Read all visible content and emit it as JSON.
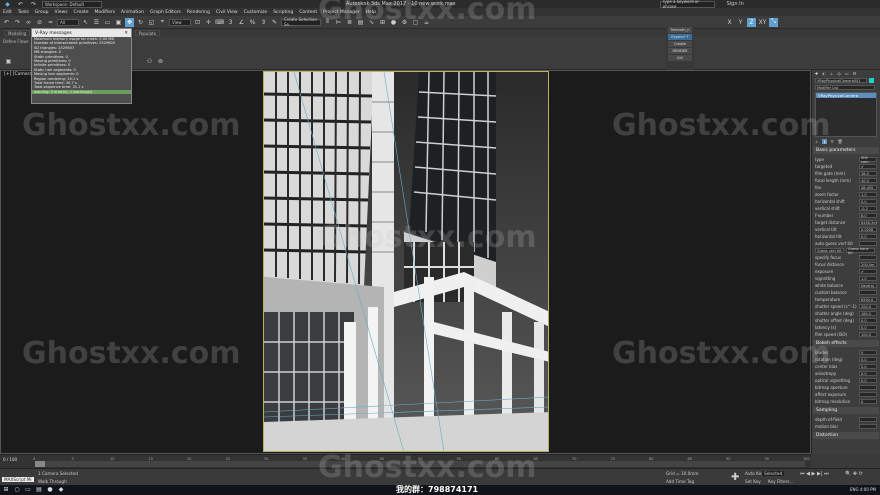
{
  "titlebar": {
    "workspace": "Workspace: Default",
    "app_title": "Autodesk 3ds Max 2017  -  10 new work.max",
    "search_placeholder": "Type a keyword or phrase",
    "sign_in": "Sign In"
  },
  "menu": [
    "Edit",
    "Tools",
    "Group",
    "Views",
    "Create",
    "Modifiers",
    "Animation",
    "Graph Editors",
    "Rendering",
    "Civil View",
    "Customize",
    "Scripting",
    "Content",
    "Project Manager",
    "Help"
  ],
  "toolbar": {
    "filter": "All",
    "view": "View",
    "selection_set": "Create Selection Se...",
    "axes": [
      "X",
      "Y",
      "Z",
      "XY"
    ]
  },
  "ribbon": {
    "tabs": [
      "Modeling",
      "Freeform",
      "Selection",
      "Object Paint",
      "Populate"
    ],
    "define_flows": "Define Flows"
  },
  "stats_window": {
    "title": "V-Ray messages",
    "lines": [
      "Maximum memory usage for mesh: 0.00 MB",
      "Number of intersectable primitives: 2529805",
      "SD triangles: 2529807",
      "MB triangles: 0",
      "Static primitives: 0",
      "Moving primitives: 0",
      "Infinite primitives: 0",
      "Static hair segments: 0",
      "Moving hair segments: 0",
      "Region rendering: 24.1 s",
      "Total frame time: 30.7 s",
      "Total sequence time: 31.1 s",
      "warning: 0 error(s), 1 warning(s)"
    ]
  },
  "render_panel": {
    "active_shade": "ActiveShade",
    "buttons": [
      "Tsmooth_n",
      "Expand ↑",
      "Create",
      "RENDER",
      "Kill"
    ]
  },
  "viewport": {
    "label": "[+] [Camera001] [Shaded]"
  },
  "command_panel": {
    "object_name": "VRayPhysicalCamera001",
    "modifier_list": "Modifier List",
    "stack_item": "VRayPhysicalCamera",
    "sections": {
      "basic": "Basic parameters",
      "bokeh": "Bokeh effects",
      "sampling": "Sampling",
      "distortion": "Distortion"
    },
    "params": [
      {
        "label": "type",
        "value": "Still cam"
      },
      {
        "label": "targeted",
        "value": "✔"
      },
      {
        "label": "film gate (mm)",
        "value": "36.0"
      },
      {
        "label": "focal length (mm)",
        "value": "40.0"
      },
      {
        "label": "fov",
        "value": "48.455"
      },
      {
        "label": "zoom factor",
        "value": "1.0"
      },
      {
        "label": "horizontal shift",
        "value": "0.0"
      },
      {
        "label": "vertical shift",
        "value": "-0.2"
      },
      {
        "label": "f-number",
        "value": "8.0"
      },
      {
        "label": "target distance",
        "value": "8456.3m"
      },
      {
        "label": "vertical tilt",
        "value": "0.0258"
      },
      {
        "label": "horizontal tilt",
        "value": "0.0"
      },
      {
        "label": "auto guess vert tilt",
        "value": ""
      }
    ],
    "guess_buttons": [
      "Guess vert tilt",
      "Guess horiz tilt"
    ],
    "params2": [
      {
        "label": "specify focus",
        "value": ""
      },
      {
        "label": "focus distance",
        "value": "200.0m"
      },
      {
        "label": "exposure",
        "value": "✔"
      },
      {
        "label": "vignetting",
        "value": "1.0"
      },
      {
        "label": "white balance",
        "value": "Neutral"
      },
      {
        "label": "custom balance",
        "value": ""
      },
      {
        "label": "temperature",
        "value": "6500.0"
      },
      {
        "label": "shutter speed (s^-1)",
        "value": "200.0"
      },
      {
        "label": "shutter angle (deg)",
        "value": "180.0"
      },
      {
        "label": "shutter offset (deg)",
        "value": "0.0"
      },
      {
        "label": "latency (s)",
        "value": "0.0"
      },
      {
        "label": "film speed (ISO)",
        "value": "100.0"
      }
    ],
    "bokeh_params": [
      {
        "label": "blades",
        "value": "5"
      },
      {
        "label": "rotation (deg)",
        "value": "0.0"
      },
      {
        "label": "center bias",
        "value": "0.0"
      },
      {
        "label": "anisotropy",
        "value": "0.0"
      },
      {
        "label": "optical vignetting",
        "value": "0.0"
      },
      {
        "label": "bitmap aperture",
        "value": ""
      },
      {
        "label": "affect exposure",
        "value": ""
      },
      {
        "label": "bitmap resolution",
        "value": "0"
      }
    ],
    "sampling_params": [
      {
        "label": "depth-of-field",
        "value": ""
      },
      {
        "label": "motion blur",
        "value": ""
      }
    ]
  },
  "timeline": {
    "frame": "0 / 100",
    "ticks": [
      "0",
      "5",
      "10",
      "15",
      "20",
      "25",
      "30",
      "35",
      "40",
      "45",
      "50",
      "55",
      "60",
      "65",
      "70",
      "75",
      "80",
      "85",
      "90",
      "95",
      "100"
    ]
  },
  "status": {
    "script": "MAXScript Mi",
    "selection": "1 Camera Selected",
    "prompt": "Walk Through",
    "grid": "Grid = 10.0mm",
    "time_tag": "Add Time Tag",
    "autokey": "Auto Key",
    "selected": "Selected",
    "setkey": "Set Key",
    "key_filters": "Key Filters..."
  },
  "watermark": {
    "text": "Ghostxx.com",
    "qq": "我的群：798874171"
  },
  "taskbar": {
    "lang": "ENG",
    "time": "4:00 PM"
  }
}
